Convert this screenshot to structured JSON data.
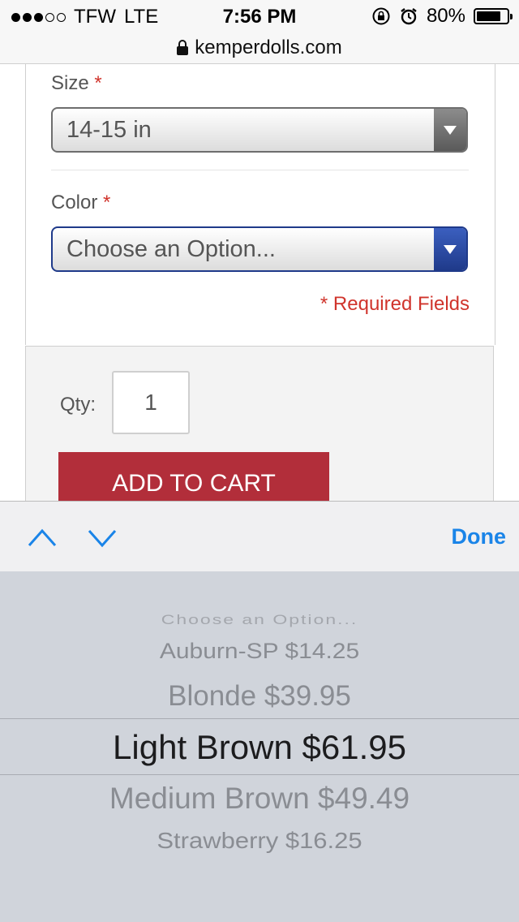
{
  "status_bar": {
    "carrier": "TFW",
    "network": "LTE",
    "time": "7:56 PM",
    "battery_percent": "80%",
    "battery_level": 0.8,
    "icons": [
      "signal-dots",
      "rotation-lock-icon",
      "alarm-icon",
      "battery-icon"
    ]
  },
  "browser": {
    "url": "kemperdolls.com"
  },
  "product_form": {
    "size_label": "Size",
    "size_required": "*",
    "size_value": "14-15 in",
    "color_label": "Color",
    "color_required": "*",
    "color_placeholder": "Choose an Option...",
    "required_note": "* Required Fields",
    "qty_label": "Qty:",
    "qty_value": "1",
    "add_to_cart_label": "ADD TO CART"
  },
  "accessory_bar": {
    "done_label": "Done"
  },
  "picker": {
    "options": [
      "Choose an Option...",
      "Auburn-SP $14.25",
      "Blonde $39.95",
      "Light Brown $61.95",
      "Medium Brown $49.49",
      "Strawberry $16.25"
    ],
    "selected": "Light Brown $61.95"
  },
  "colors": {
    "accent_blue": "#1a84e8",
    "add_to_cart_red": "#b22e3a",
    "required_red": "#d0342c",
    "select_active_border": "#1f3a8a"
  }
}
